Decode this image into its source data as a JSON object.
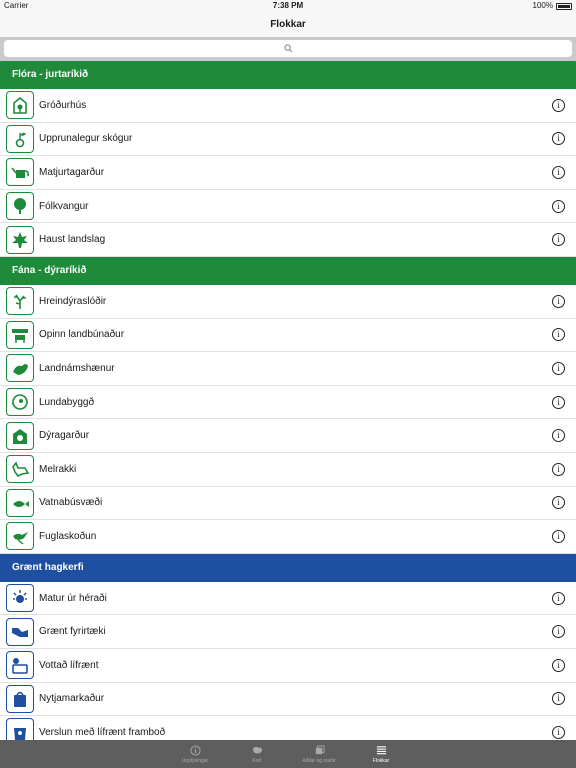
{
  "status": {
    "carrier": "Carrier",
    "time": "7:38 PM",
    "battery": "100%",
    "battery_level": 1.0
  },
  "nav": {
    "title": "Flokkar"
  },
  "search": {
    "placeholder": ""
  },
  "colors": {
    "green": "#1e8a3a",
    "blue": "#1f4fa0",
    "tabbar": "#5e5e5e"
  },
  "sections": [
    {
      "title": "Flóra - jurtaríkið",
      "color": "#1e8a3a",
      "items": [
        {
          "label": "Gróðurhús",
          "icon": "greenhouse-icon"
        },
        {
          "label": "Upprunalegur skógur",
          "icon": "sprout-icon"
        },
        {
          "label": "Matjurtagarður",
          "icon": "watering-can-icon"
        },
        {
          "label": "Fólkvangur",
          "icon": "tree-icon"
        },
        {
          "label": "Haust landslag",
          "icon": "maple-leaf-icon"
        }
      ]
    },
    {
      "title": "Fána - dýraríkið",
      "color": "#1e8a3a",
      "items": [
        {
          "label": "Hreindýraslóðir",
          "icon": "antler-icon"
        },
        {
          "label": "Opinn landbúnaður",
          "icon": "farm-cow-icon"
        },
        {
          "label": "Landnámshænur",
          "icon": "hen-icon"
        },
        {
          "label": "Lundabyggð",
          "icon": "puffin-icon"
        },
        {
          "label": "Dýragarður",
          "icon": "zoo-icon"
        },
        {
          "label": "Melrakki",
          "icon": "fox-icon"
        },
        {
          "label": "Vatnabúsvæði",
          "icon": "fish-icon"
        },
        {
          "label": "Fuglaskoðun",
          "icon": "bird-icon"
        }
      ]
    },
    {
      "title": "Grænt hagkerfi",
      "color": "#1f4fa0",
      "items": [
        {
          "label": "Matur úr héraði",
          "icon": "local-food-icon"
        },
        {
          "label": "Grænt fyrirtæki",
          "icon": "handshake-icon"
        },
        {
          "label": "Vottað lífrænt",
          "icon": "organic-icon"
        },
        {
          "label": "Nytjamarkaður",
          "icon": "recycle-bag-icon"
        },
        {
          "label": "Verslun með lífrænt framboð",
          "icon": "shop-icon"
        }
      ]
    }
  ],
  "tabs": [
    {
      "label": "Upplýsingar",
      "icon": "info-icon",
      "active": false
    },
    {
      "label": "Kort",
      "icon": "map-icon",
      "active": false
    },
    {
      "label": "Aðilar og staðir",
      "icon": "places-icon",
      "active": false
    },
    {
      "label": "Flokkar",
      "icon": "list-icon",
      "active": true
    }
  ]
}
